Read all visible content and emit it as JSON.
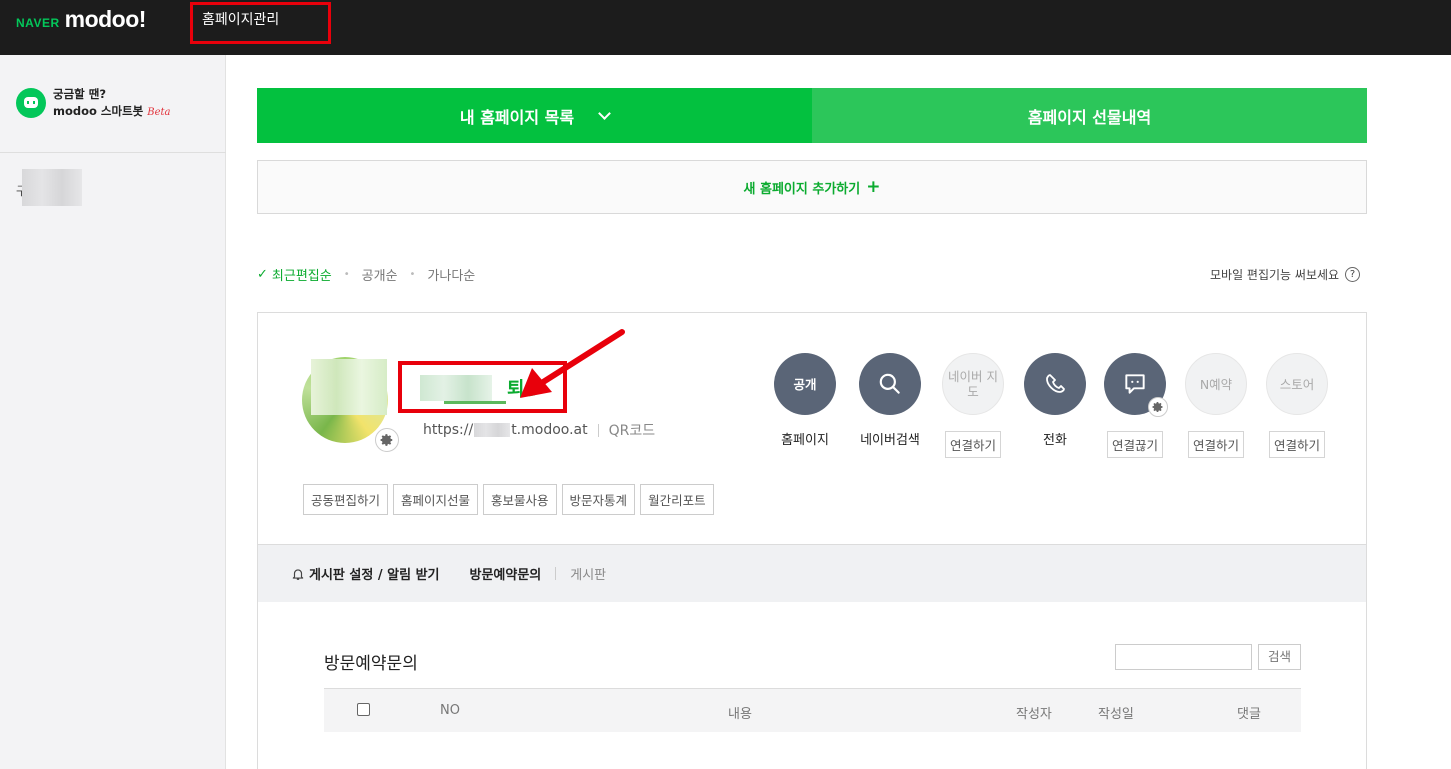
{
  "header": {
    "logo_naver": "NAVER",
    "logo_modoo": "modoo!",
    "nav_label": "홈페이지관리"
  },
  "sidebar": {
    "bot_line1": "궁금할 땐?",
    "bot_line2": "modoo 스마트봇",
    "bot_beta": "Beta",
    "item_prefix": "구"
  },
  "tabs": {
    "my_list": "내 홈페이지 목록",
    "gift_history": "홈페이지 선물내역"
  },
  "add_new": {
    "label": "새 홈페이지 추가하기",
    "plus": "+"
  },
  "sort": {
    "check": "✓",
    "recent": "최근편집순",
    "public": "공개순",
    "alpha": "가나다순",
    "mobile_tip": "모바일 편집기능 써보세요",
    "help": "?"
  },
  "site": {
    "title_suffix": "퇴",
    "url_prefix": "https://",
    "url_suffix": "t.modoo.at",
    "qr": "QR코드"
  },
  "services": [
    {
      "circle": "공개",
      "label": "홈페이지"
    },
    {
      "circle": "",
      "label": "네이버검색"
    },
    {
      "circle": "네이버 지도",
      "label": "연결하기"
    },
    {
      "circle": "",
      "label": "전화"
    },
    {
      "circle": "",
      "label": "연결끊기"
    },
    {
      "circle": "N예약",
      "label": "연결하기"
    },
    {
      "circle": "스토어",
      "label": "연결하기"
    }
  ],
  "chips": [
    "공동편집하기",
    "홈페이지선물",
    "홍보물사용",
    "방문자통계",
    "월간리포트"
  ],
  "board_nav": {
    "settings": "게시판 설정 / 알림 받기",
    "active": "방문예약문의",
    "other": "게시판"
  },
  "board": {
    "title": "방문예약문의",
    "search_btn": "검색",
    "columns": [
      "NO",
      "내용",
      "작성자",
      "작성일",
      "댓글"
    ]
  }
}
